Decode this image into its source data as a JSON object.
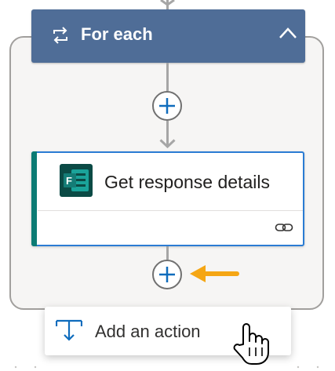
{
  "foreach": {
    "title": "For each"
  },
  "action": {
    "title": "Get response details"
  },
  "menu": {
    "add_action_label": "Add an action"
  },
  "colors": {
    "header_bg": "#4f6d97",
    "card_border": "#2b7cd3",
    "card_accent": "#0c7b74",
    "plus_blue": "#0f6cbd",
    "arrow_orange": "#f5a614"
  },
  "icons": {
    "loop": "loop-icon",
    "collapse": "chevron-up-icon",
    "forms": "microsoft-forms-icon",
    "link": "link-icon",
    "add_action": "add-action-icon",
    "cursor": "hand-pointer-icon"
  }
}
